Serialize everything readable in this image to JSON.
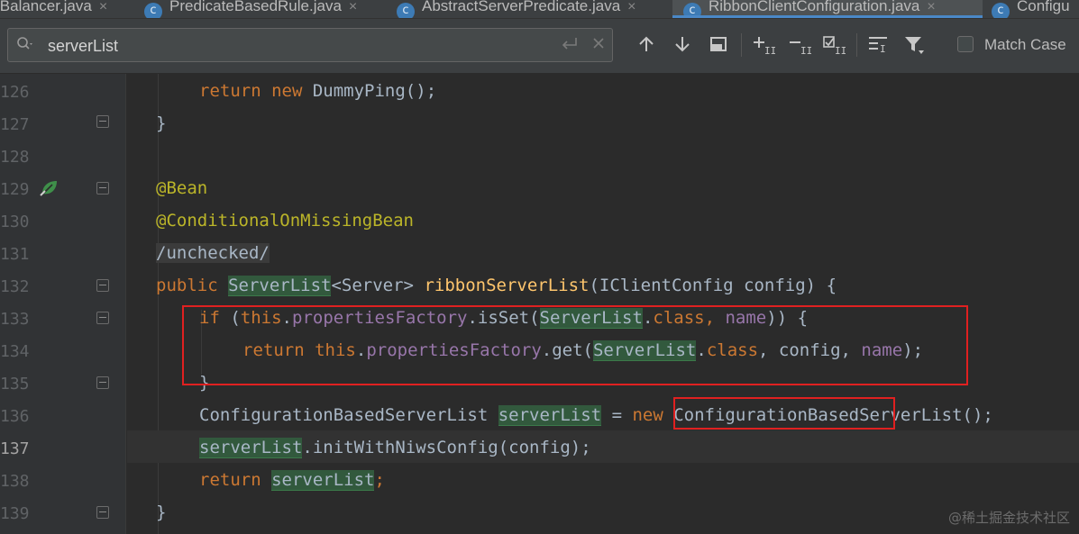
{
  "tabs": [
    {
      "label": "lBalancer.java",
      "icon": "",
      "close": "×"
    },
    {
      "label": "PredicateBasedRule.java",
      "icon": "c",
      "close": "×"
    },
    {
      "label": "AbstractServerPredicate.java",
      "icon": "c",
      "close": "×"
    },
    {
      "label": "RibbonClientConfiguration.java",
      "icon": "c",
      "close": "×"
    },
    {
      "label": "Configu",
      "icon": "c",
      "close": ""
    }
  ],
  "search": {
    "value": "serverList",
    "match_case_label": "Match Case"
  },
  "icons": {
    "search": "search-icon",
    "enter": "enter-icon",
    "clear": "clear-icon",
    "prev": "arrow-up-icon",
    "next": "arrow-down-icon",
    "in_selection": "square-icon",
    "add_occurrence": "add-occurrence-icon",
    "remove_occurrence": "remove-occurrence-icon",
    "select_all": "select-all-icon",
    "context": "context-icon",
    "filter": "filter-icon"
  },
  "line_numbers": [
    "126",
    "127",
    "128",
    "129",
    "130",
    "131",
    "132",
    "133",
    "134",
    "135",
    "136",
    "137",
    "138",
    "139"
  ],
  "code": {
    "l126": {
      "k1": "return",
      "k2": "new",
      "t1": " DummyPing();"
    },
    "l127": {
      "t1": "}"
    },
    "l129": {
      "an": "@Bean"
    },
    "l130": {
      "an": "@ConditionalOnMissingBean"
    },
    "l131": {
      "cm": "/unchecked/"
    },
    "l132": {
      "k1": "public",
      "hl1": "ServerList",
      "t1": "<Server> ",
      "m1": "ribbonServerList",
      "t2": "(IClientConfig config) {"
    },
    "l133": {
      "k1": "if",
      "t1": " (",
      "k2": "this",
      "t2": ".",
      "f1": "propertiesFactory",
      "t3": ".isSet(",
      "hl1": "ServerList",
      "t4": ".",
      "k3": "class",
      "t5": ", ",
      "f2": "name",
      "t6": ")) {"
    },
    "l134": {
      "k1": "return",
      "k2": "this",
      "t1": ".",
      "f1": "propertiesFactory",
      "t2": ".get(",
      "hl1": "ServerList",
      "t3": ".",
      "k3": "class",
      "t4": ", config, ",
      "f2": "name",
      "t5": ");"
    },
    "l135": {
      "t1": "}"
    },
    "l136": {
      "t1": "ConfigurationBasedServerList ",
      "hl1": "serverList",
      "t2": " = ",
      "k1": "new",
      "t3": " ConfigurationBasedServerList();"
    },
    "l137": {
      "hl1": "serverList",
      "t1": ".initWithNiwsConfig(config);"
    },
    "l138": {
      "k1": "return",
      "hl1": "serverList",
      "t1": ";"
    },
    "l139": {
      "t1": "}"
    }
  },
  "watermark": "@稀土掘金技术社区",
  "colors": {
    "keyword": "#cc7832",
    "annotation": "#bbb529",
    "field": "#9876aa",
    "method": "#ffc66d",
    "highlight": "#32593d",
    "annotation_box": "#e02020"
  }
}
